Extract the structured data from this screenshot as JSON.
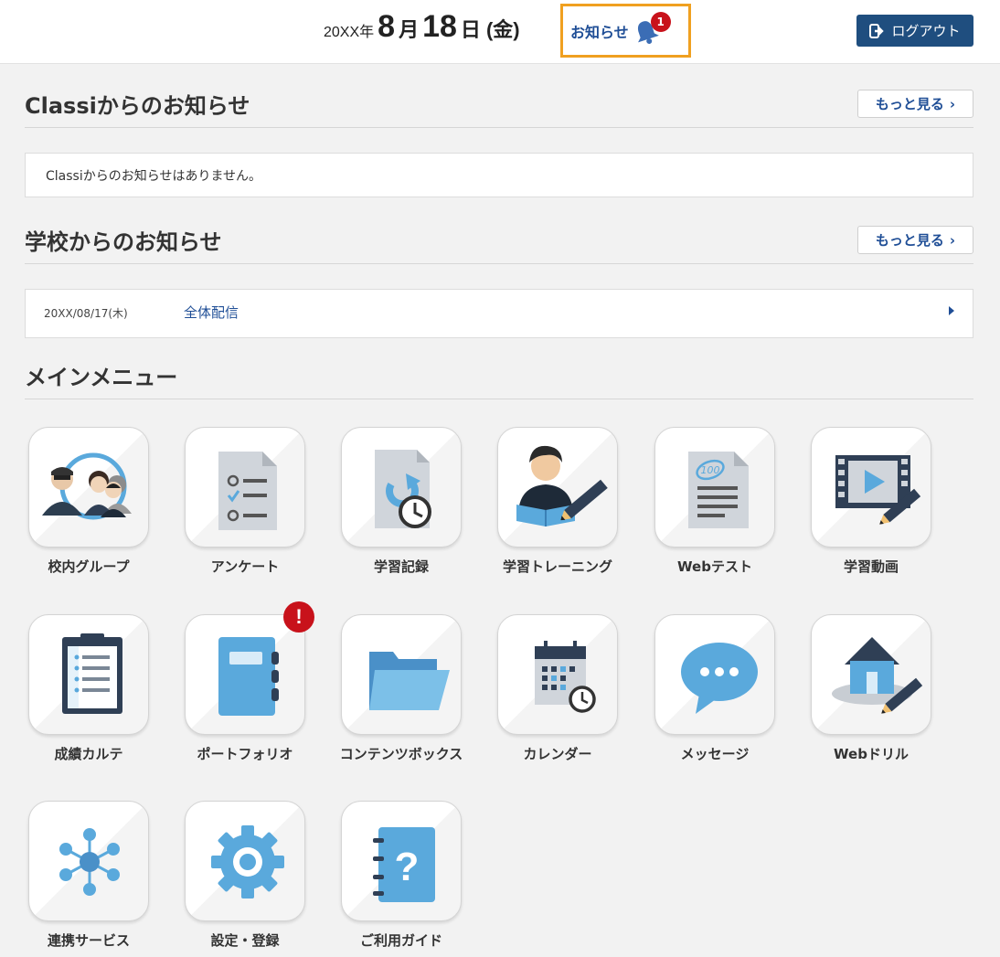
{
  "header": {
    "year": "20XX年",
    "month": "8",
    "month_unit": "月",
    "day": "18",
    "day_unit": "日",
    "weekday": "(金)",
    "notice_label": "お知らせ",
    "notice_count": "1",
    "logout_label": "ログアウト"
  },
  "classi_news": {
    "title": "Classiからのお知らせ",
    "more_label": "もっと見る",
    "empty_message": "Classiからのお知らせはありません。"
  },
  "school_news": {
    "title": "学校からのお知らせ",
    "more_label": "もっと見る",
    "items": [
      {
        "date": "20XX/08/17(木)",
        "title": "全体配信"
      }
    ]
  },
  "main_menu": {
    "title": "メインメニュー",
    "items": [
      {
        "label": "校内グループ",
        "icon": "group-icon"
      },
      {
        "label": "アンケート",
        "icon": "survey-icon"
      },
      {
        "label": "学習記録",
        "icon": "study-record-icon"
      },
      {
        "label": "学習トレーニング",
        "icon": "study-training-icon"
      },
      {
        "label": "Webテスト",
        "icon": "web-test-icon"
      },
      {
        "label": "学習動画",
        "icon": "study-video-icon"
      },
      {
        "label": "成績カルテ",
        "icon": "grade-chart-icon"
      },
      {
        "label": "ポートフォリオ",
        "icon": "portfolio-icon",
        "alert": "!"
      },
      {
        "label": "コンテンツボックス",
        "icon": "folder-icon"
      },
      {
        "label": "カレンダー",
        "icon": "calendar-icon"
      },
      {
        "label": "メッセージ",
        "icon": "message-icon"
      },
      {
        "label": "Webドリル",
        "icon": "web-drill-icon"
      },
      {
        "label": "連携サービス",
        "icon": "linked-services-icon"
      },
      {
        "label": "設定・登録",
        "icon": "settings-icon"
      },
      {
        "label": "ご利用ガイド",
        "icon": "guide-icon"
      }
    ]
  },
  "colors": {
    "accent_blue": "#1f4e96",
    "icon_blue": "#5aa9dc",
    "alert_red": "#c8121b",
    "highlight_orange": "#f0a020"
  }
}
